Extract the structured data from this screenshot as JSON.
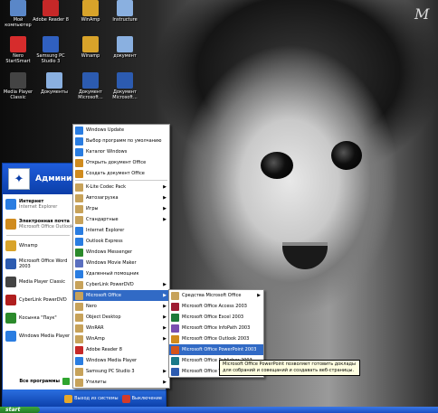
{
  "wallpaper_logo": "M",
  "desktop_icons": [
    {
      "label": "Мой компьютер",
      "color": "#5a87c8"
    },
    {
      "label": "Adobe Reader 8",
      "color": "#c62828"
    },
    {
      "label": "WinAmp",
      "color": "#d8a32a"
    },
    {
      "label": "Instructure",
      "color": "#8ab0e0"
    },
    {
      "label": "Nero StartSmart",
      "color": "#d62c2c"
    },
    {
      "label": "Samsung PC Studio 3",
      "color": "#3060c0"
    },
    {
      "label": "Winamp",
      "color": "#d8a32a"
    },
    {
      "label": "документ",
      "color": "#8ab0e0"
    },
    {
      "label": "Media Player Classic",
      "color": "#444444"
    },
    {
      "label": "Документы",
      "color": "#8ab0e0"
    },
    {
      "label": "Документ Microsoft...",
      "color": "#2c5bb0"
    },
    {
      "label": "Документ Microsoft...",
      "color": "#2c5bb0"
    }
  ],
  "start_menu": {
    "user_name": "Админист",
    "pinned": [
      {
        "title": "Интернет",
        "subtitle": "Internet Explorer",
        "color": "#2a7de1"
      },
      {
        "title": "Электронная почта",
        "subtitle": "Microsoft Office Outlook",
        "color": "#d08b1e"
      }
    ],
    "recent": [
      {
        "title": "Winamp",
        "color": "#d8a32a"
      },
      {
        "title": "Microsoft Office Word 2003",
        "color": "#2c5bb0"
      },
      {
        "title": "Media Player Classic",
        "color": "#444444"
      },
      {
        "title": "CyberLink PowerDVD",
        "color": "#b01e1e"
      },
      {
        "title": "Косынка \"Паук\"",
        "color": "#2b8a2b"
      },
      {
        "title": "Windows Media Player",
        "color": "#2a7de1"
      }
    ],
    "all_programs": "Все программы",
    "logoff": "Выход из системы",
    "shutdown": "Выключение"
  },
  "programs_menu": {
    "top": [
      {
        "label": "Windows Update",
        "color": "#2a7de1"
      },
      {
        "label": "Выбор программ по умолчанию",
        "color": "#2a7de1"
      },
      {
        "label": "Каталог Windows",
        "color": "#2a7de1"
      },
      {
        "label": "Открыть документ Office",
        "color": "#d08b1e"
      },
      {
        "label": "Создать документ Office",
        "color": "#d08b1e"
      }
    ],
    "items": [
      {
        "label": "K-Lite Codec Pack",
        "submenu": true,
        "color": "#c7a25a"
      },
      {
        "label": "Автозагрузка",
        "submenu": true,
        "color": "#c7a25a"
      },
      {
        "label": "Игры",
        "submenu": true,
        "color": "#c7a25a"
      },
      {
        "label": "Стандартные",
        "submenu": true,
        "color": "#c7a25a"
      },
      {
        "label": "Internet Explorer",
        "submenu": false,
        "color": "#2a7de1"
      },
      {
        "label": "Outlook Express",
        "submenu": false,
        "color": "#2a7de1"
      },
      {
        "label": "Windows Messenger",
        "submenu": false,
        "color": "#2b8a2b"
      },
      {
        "label": "Windows Movie Maker",
        "submenu": false,
        "color": "#5a6fbf"
      },
      {
        "label": "Удаленный помощник",
        "submenu": false,
        "color": "#2a7de1"
      },
      {
        "label": "CyberLink PowerDVD",
        "submenu": true,
        "color": "#c7a25a"
      },
      {
        "label": "Microsoft Office",
        "submenu": true,
        "color": "#c7a25a",
        "highlighted": true
      },
      {
        "label": "Nero",
        "submenu": true,
        "color": "#c7a25a"
      },
      {
        "label": "Object Desktop",
        "submenu": true,
        "color": "#c7a25a"
      },
      {
        "label": "WinRAR",
        "submenu": true,
        "color": "#c7a25a"
      },
      {
        "label": "WinAmp",
        "submenu": true,
        "color": "#c7a25a"
      },
      {
        "label": "Adobe Reader 8",
        "submenu": false,
        "color": "#c62828"
      },
      {
        "label": "Windows Media Player",
        "submenu": false,
        "color": "#2a7de1"
      },
      {
        "label": "Samsung PC Studio 3",
        "submenu": true,
        "color": "#c7a25a"
      },
      {
        "label": "Утилиты",
        "submenu": true,
        "color": "#c7a25a"
      }
    ]
  },
  "office_menu": {
    "items": [
      {
        "label": "Средства Microsoft Office",
        "submenu": true,
        "color": "#c7a25a"
      },
      {
        "label": "Microsoft Office Access 2003",
        "submenu": false,
        "color": "#9e1b32"
      },
      {
        "label": "Microsoft Office Excel 2003",
        "submenu": false,
        "color": "#1f7a3a"
      },
      {
        "label": "Microsoft Office InfoPath 2003",
        "submenu": false,
        "color": "#7a4fb0"
      },
      {
        "label": "Microsoft Office Outlook 2003",
        "submenu": false,
        "color": "#d08b1e"
      },
      {
        "label": "Microsoft Office PowerPoint 2003",
        "submenu": false,
        "color": "#d3541b",
        "highlighted": true
      },
      {
        "label": "Microsoft Office Publisher 2003",
        "submenu": false,
        "color": "#1a7a8a"
      },
      {
        "label": "Microsoft Office Word 2003",
        "submenu": false,
        "color": "#2c5bb0"
      }
    ]
  },
  "tooltip": "Microsoft Office PowerPoint позволяет готовить доклады для собраний и совещаний и создавать веб-страницы.",
  "taskbar": {
    "start_label": "start"
  }
}
